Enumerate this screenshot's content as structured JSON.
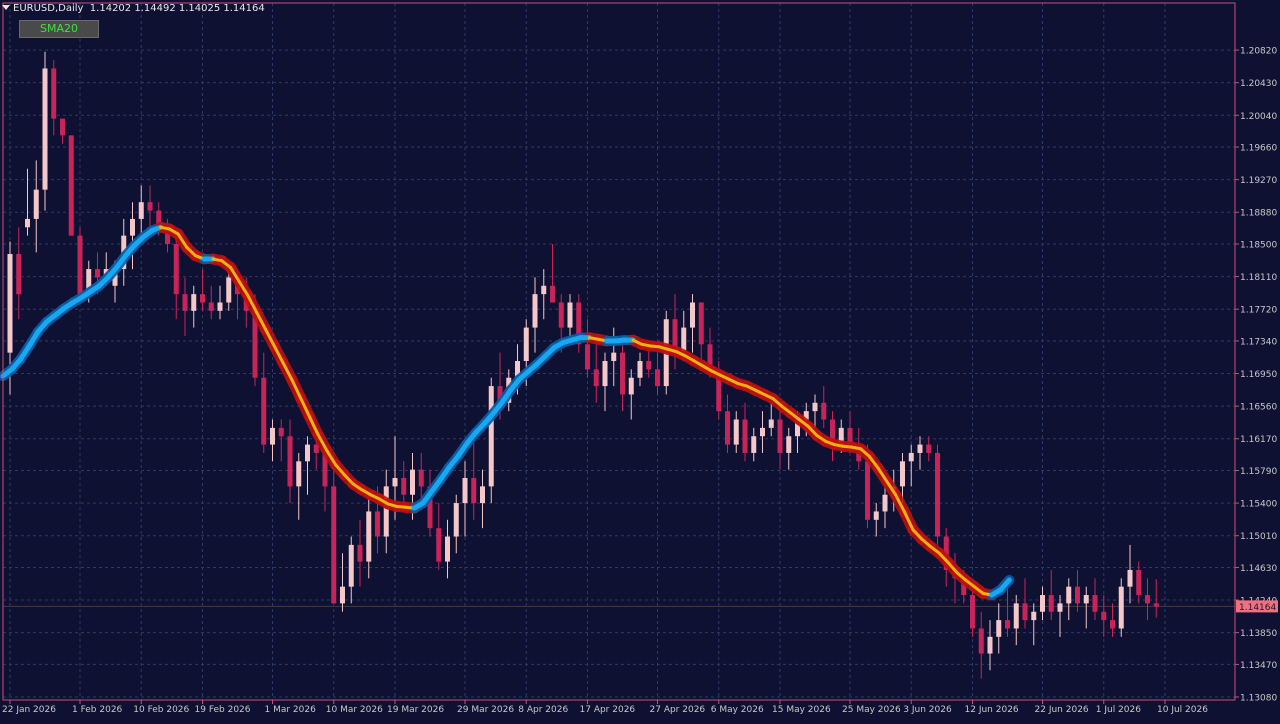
{
  "header": {
    "symbol": "EURUSD,Daily",
    "ohlc": "1.14202 1.14492 1.14025 1.14164"
  },
  "indicator": {
    "button_label": "SMA20"
  },
  "colors": {
    "background": "#0f1133",
    "grid": "#2c3a66",
    "frame": "#c8507a",
    "bull_candle": "#f4c8c8",
    "bear_candle": "#c8245a",
    "sma_up": "#18a8f0",
    "sma_down": "#f0b010",
    "sma_down_glow": "#c01010",
    "price_label_bg": "#f07080",
    "price_line": "#4a3838"
  },
  "chart_data": {
    "type": "candlestick",
    "symbol": "EURUSD",
    "timeframe": "Daily",
    "current_price": 1.14164,
    "ylim": [
      1.1308,
      1.2118
    ],
    "y_ticks": [
      1.2082,
      1.2043,
      1.2004,
      1.1966,
      1.1927,
      1.1888,
      1.185,
      1.1811,
      1.1772,
      1.1734,
      1.1695,
      1.1656,
      1.1617,
      1.1579,
      1.154,
      1.1501,
      1.1463,
      1.1424,
      1.1385,
      1.1347,
      1.1308
    ],
    "y_tick_labels": [
      "1.20820",
      "1.20430",
      "1.20040",
      "1.19660",
      "1.19270",
      "1.18880",
      "1.18500",
      "1.18110",
      "1.17720",
      "1.17340",
      "1.16950",
      "1.16560",
      "1.16170",
      "1.15790",
      "1.15400",
      "1.15010",
      "1.14630",
      "1.14240",
      "1.13850",
      "1.13470",
      "1.13080"
    ],
    "x_labels": [
      "22 Jan 2026",
      "1 Feb 2026",
      "10 Feb 2026",
      "19 Feb 2026",
      "1 Mar 2026",
      "10 Mar 2026",
      "19 Mar 2026",
      "29 Mar 2026",
      "8 Apr 2026",
      "17 Apr 2026",
      "27 Apr 2026",
      "6 May 2026",
      "15 May 2026",
      "25 May 2026",
      "3 Jun 2026",
      "12 Jun 2026",
      "22 Jun 2026",
      "1 Jul 2026",
      "10 Jul 2026"
    ],
    "x_label_index": [
      0,
      8,
      15,
      22,
      30,
      37,
      44,
      52,
      59,
      66,
      74,
      81,
      88,
      96,
      103,
      110,
      118,
      125,
      132
    ],
    "candles": [
      [
        1.172,
        1.1853,
        1.167,
        1.1838
      ],
      [
        1.1838,
        1.187,
        1.176,
        1.179
      ],
      [
        1.187,
        1.194,
        1.186,
        1.188
      ],
      [
        1.188,
        1.195,
        1.184,
        1.1915
      ],
      [
        1.1915,
        1.208,
        1.189,
        1.206
      ],
      [
        1.206,
        1.207,
        1.198,
        1.2
      ],
      [
        1.2,
        1.199,
        1.197,
        1.198
      ],
      [
        1.198,
        1.198,
        1.186,
        1.186
      ],
      [
        1.186,
        1.187,
        1.178,
        1.179
      ],
      [
        1.179,
        1.183,
        1.178,
        1.182
      ],
      [
        1.182,
        1.184,
        1.179,
        1.181
      ],
      [
        1.181,
        1.184,
        1.18,
        1.182
      ],
      [
        1.18,
        1.183,
        1.178,
        1.182
      ],
      [
        1.182,
        1.188,
        1.18,
        1.186
      ],
      [
        1.186,
        1.19,
        1.182,
        1.188
      ],
      [
        1.188,
        1.192,
        1.186,
        1.19
      ],
      [
        1.19,
        1.192,
        1.187,
        1.189
      ],
      [
        1.189,
        1.19,
        1.186,
        1.187
      ],
      [
        1.187,
        1.188,
        1.184,
        1.185
      ],
      [
        1.185,
        1.186,
        1.176,
        1.179
      ],
      [
        1.179,
        1.181,
        1.174,
        1.177
      ],
      [
        1.177,
        1.18,
        1.175,
        1.179
      ],
      [
        1.179,
        1.182,
        1.177,
        1.178
      ],
      [
        1.178,
        1.18,
        1.176,
        1.177
      ],
      [
        1.177,
        1.18,
        1.176,
        1.178
      ],
      [
        1.178,
        1.182,
        1.177,
        1.181
      ],
      [
        1.181,
        1.182,
        1.176,
        1.179
      ],
      [
        1.179,
        1.181,
        1.175,
        1.177
      ],
      [
        1.177,
        1.179,
        1.168,
        1.169
      ],
      [
        1.169,
        1.172,
        1.16,
        1.161
      ],
      [
        1.161,
        1.164,
        1.159,
        1.163
      ],
      [
        1.163,
        1.164,
        1.159,
        1.162
      ],
      [
        1.162,
        1.164,
        1.154,
        1.156
      ],
      [
        1.156,
        1.16,
        1.152,
        1.159
      ],
      [
        1.159,
        1.162,
        1.155,
        1.161
      ],
      [
        1.161,
        1.163,
        1.158,
        1.16
      ],
      [
        1.16,
        1.162,
        1.153,
        1.156
      ],
      [
        1.156,
        1.16,
        1.145,
        1.142
      ],
      [
        1.142,
        1.148,
        1.141,
        1.144
      ],
      [
        1.144,
        1.15,
        1.142,
        1.149
      ],
      [
        1.149,
        1.152,
        1.144,
        1.147
      ],
      [
        1.147,
        1.155,
        1.145,
        1.153
      ],
      [
        1.153,
        1.156,
        1.148,
        1.15
      ],
      [
        1.15,
        1.158,
        1.148,
        1.156
      ],
      [
        1.156,
        1.162,
        1.152,
        1.157
      ],
      [
        1.157,
        1.159,
        1.153,
        1.155
      ],
      [
        1.155,
        1.16,
        1.152,
        1.158
      ],
      [
        1.158,
        1.16,
        1.154,
        1.156
      ],
      [
        1.156,
        1.158,
        1.15,
        1.151
      ],
      [
        1.151,
        1.154,
        1.146,
        1.147
      ],
      [
        1.147,
        1.152,
        1.145,
        1.15
      ],
      [
        1.15,
        1.155,
        1.148,
        1.154
      ],
      [
        1.154,
        1.159,
        1.15,
        1.157
      ],
      [
        1.157,
        1.162,
        1.152,
        1.154
      ],
      [
        1.154,
        1.158,
        1.151,
        1.156
      ],
      [
        1.156,
        1.169,
        1.154,
        1.168
      ],
      [
        1.168,
        1.172,
        1.164,
        1.166
      ],
      [
        1.166,
        1.17,
        1.165,
        1.169
      ],
      [
        1.169,
        1.173,
        1.167,
        1.171
      ],
      [
        1.171,
        1.176,
        1.168,
        1.175
      ],
      [
        1.175,
        1.181,
        1.172,
        1.179
      ],
      [
        1.179,
        1.182,
        1.176,
        1.18
      ],
      [
        1.18,
        1.185,
        1.178,
        1.178
      ],
      [
        1.178,
        1.179,
        1.172,
        1.175
      ],
      [
        1.175,
        1.179,
        1.174,
        1.178
      ],
      [
        1.178,
        1.179,
        1.172,
        1.173
      ],
      [
        1.173,
        1.176,
        1.169,
        1.17
      ],
      [
        1.17,
        1.173,
        1.166,
        1.168
      ],
      [
        1.168,
        1.172,
        1.165,
        1.171
      ],
      [
        1.171,
        1.175,
        1.168,
        1.172
      ],
      [
        1.172,
        1.174,
        1.165,
        1.167
      ],
      [
        1.167,
        1.17,
        1.164,
        1.169
      ],
      [
        1.169,
        1.172,
        1.168,
        1.171
      ],
      [
        1.171,
        1.173,
        1.169,
        1.17
      ],
      [
        1.17,
        1.172,
        1.167,
        1.168
      ],
      [
        1.168,
        1.177,
        1.167,
        1.176
      ],
      [
        1.176,
        1.179,
        1.17,
        1.172
      ],
      [
        1.172,
        1.177,
        1.171,
        1.175
      ],
      [
        1.175,
        1.179,
        1.172,
        1.178
      ],
      [
        1.178,
        1.178,
        1.171,
        1.173
      ],
      [
        1.173,
        1.175,
        1.169,
        1.17
      ],
      [
        1.17,
        1.171,
        1.164,
        1.165
      ],
      [
        1.165,
        1.167,
        1.16,
        1.161
      ],
      [
        1.161,
        1.165,
        1.16,
        1.164
      ],
      [
        1.164,
        1.166,
        1.159,
        1.16
      ],
      [
        1.16,
        1.163,
        1.159,
        1.162
      ],
      [
        1.162,
        1.165,
        1.16,
        1.163
      ],
      [
        1.163,
        1.166,
        1.162,
        1.164
      ],
      [
        1.164,
        1.165,
        1.158,
        1.16
      ],
      [
        1.16,
        1.163,
        1.158,
        1.162
      ],
      [
        1.162,
        1.165,
        1.16,
        1.164
      ],
      [
        1.164,
        1.166,
        1.162,
        1.165
      ],
      [
        1.165,
        1.167,
        1.163,
        1.166
      ],
      [
        1.166,
        1.168,
        1.163,
        1.164
      ],
      [
        1.164,
        1.165,
        1.159,
        1.161
      ],
      [
        1.161,
        1.164,
        1.16,
        1.163
      ],
      [
        1.163,
        1.165,
        1.16,
        1.161
      ],
      [
        1.161,
        1.163,
        1.158,
        1.159
      ],
      [
        1.159,
        1.161,
        1.151,
        1.152
      ],
      [
        1.152,
        1.154,
        1.15,
        1.153
      ],
      [
        1.153,
        1.156,
        1.151,
        1.155
      ],
      [
        1.155,
        1.158,
        1.153,
        1.156
      ],
      [
        1.156,
        1.16,
        1.154,
        1.159
      ],
      [
        1.159,
        1.161,
        1.156,
        1.16
      ],
      [
        1.16,
        1.162,
        1.158,
        1.161
      ],
      [
        1.161,
        1.162,
        1.159,
        1.16
      ],
      [
        1.16,
        1.161,
        1.149,
        1.15
      ],
      [
        1.15,
        1.151,
        1.144,
        1.146
      ],
      [
        1.146,
        1.148,
        1.142,
        1.145
      ],
      [
        1.145,
        1.146,
        1.142,
        1.143
      ],
      [
        1.143,
        1.144,
        1.138,
        1.139
      ],
      [
        1.139,
        1.141,
        1.133,
        1.136
      ],
      [
        1.136,
        1.14,
        1.134,
        1.138
      ],
      [
        1.138,
        1.142,
        1.136,
        1.14
      ],
      [
        1.14,
        1.144,
        1.138,
        1.139
      ],
      [
        1.139,
        1.143,
        1.137,
        1.142
      ],
      [
        1.142,
        1.145,
        1.139,
        1.14
      ],
      [
        1.14,
        1.142,
        1.137,
        1.141
      ],
      [
        1.141,
        1.144,
        1.14,
        1.143
      ],
      [
        1.143,
        1.146,
        1.14,
        1.141
      ],
      [
        1.141,
        1.143,
        1.138,
        1.142
      ],
      [
        1.142,
        1.145,
        1.14,
        1.144
      ],
      [
        1.144,
        1.146,
        1.141,
        1.142
      ],
      [
        1.142,
        1.144,
        1.139,
        1.143
      ],
      [
        1.143,
        1.145,
        1.14,
        1.141
      ],
      [
        1.141,
        1.143,
        1.138,
        1.14
      ],
      [
        1.14,
        1.142,
        1.138,
        1.139
      ],
      [
        1.139,
        1.145,
        1.138,
        1.144
      ],
      [
        1.144,
        1.149,
        1.142,
        1.146
      ],
      [
        1.146,
        1.147,
        1.142,
        1.143
      ],
      [
        1.143,
        1.145,
        1.14,
        1.142
      ],
      [
        1.142,
        1.1449,
        1.1403,
        1.1416
      ]
    ],
    "sma20": [
      1.1692,
      1.17,
      1.1712,
      1.1728,
      1.1745,
      1.1757,
      1.1765,
      1.1773,
      1.178,
      1.1786,
      1.1793,
      1.18,
      1.181,
      1.1822,
      1.1836,
      1.1848,
      1.1858,
      1.1866,
      1.187,
      1.1868,
      1.1862,
      1.1846,
      1.1836,
      1.1832,
      1.1832,
      1.183,
      1.1822,
      1.1805,
      1.1788,
      1.1768,
      1.1748,
      1.1728,
      1.1708,
      1.1688,
      1.1666,
      1.1644,
      1.1622,
      1.1603,
      1.1586,
      1.1574,
      1.1563,
      1.1556,
      1.155,
      1.1545,
      1.1539,
      1.1536,
      1.1535,
      1.1534,
      1.154,
      1.1554,
      1.1568,
      1.1583,
      1.1596,
      1.1611,
      1.1624,
      1.1635,
      1.1647,
      1.166,
      1.1675,
      1.1688,
      1.1697,
      1.1706,
      1.1716,
      1.1726,
      1.1732,
      1.1735,
      1.1738,
      1.1738,
      1.1736,
      1.1734,
      1.1734,
      1.1735,
      1.1735,
      1.173,
      1.1728,
      1.1727,
      1.1724,
      1.1721,
      1.1716,
      1.171,
      1.1704,
      1.1698,
      1.1693,
      1.1688,
      1.1683,
      1.168,
      1.1675,
      1.167,
      1.1665,
      1.1656,
      1.1648,
      1.164,
      1.1632,
      1.1621,
      1.1614,
      1.161,
      1.1608,
      1.1607,
      1.1605,
      1.1596,
      1.1582,
      1.1566,
      1.155,
      1.153,
      1.1508,
      1.1497,
      1.1488,
      1.148,
      1.1469,
      1.1457,
      1.1448,
      1.144,
      1.1432,
      1.143,
      1.1436,
      1.1448
    ],
    "sma20_first_index": 0
  }
}
